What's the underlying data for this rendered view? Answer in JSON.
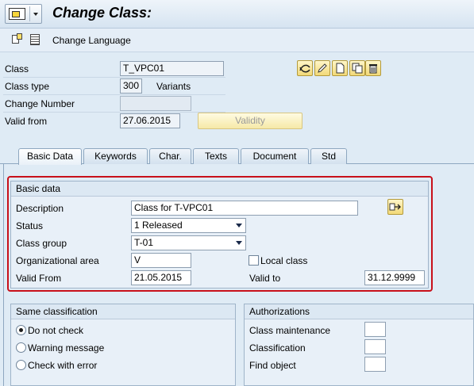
{
  "title": "Change Class:",
  "toolbar": {
    "change_language": "Change Language"
  },
  "header": {
    "class_label": "Class",
    "class_value": "T_VPC01",
    "class_type_label": "Class type",
    "class_type_value": "300",
    "class_type_text": "Variants",
    "change_number_label": "Change Number",
    "change_number_value": "",
    "valid_from_label": "Valid from",
    "valid_from_value": "27.06.2015",
    "validity_button": "Validity"
  },
  "tabs": [
    "Basic Data",
    "Keywords",
    "Char.",
    "Texts",
    "Document",
    "Std"
  ],
  "active_tab": "Basic Data",
  "basic_data": {
    "group_title": "Basic data",
    "description_label": "Description",
    "description_value": "Class for T-VPC01",
    "status_label": "Status",
    "status_value": "1 Released",
    "class_group_label": "Class group",
    "class_group_value": "T-01",
    "org_area_label": "Organizational area",
    "org_area_value": "V",
    "local_class_label": "Local class",
    "local_class_checked": false,
    "valid_from_label": "Valid From",
    "valid_from_value": "21.05.2015",
    "valid_to_label": "Valid to",
    "valid_to_value": "31.12.9999"
  },
  "same_classification": {
    "title": "Same classification",
    "options": [
      "Do not check",
      "Warning message",
      "Check with error"
    ],
    "selected": "Do not check"
  },
  "authorizations": {
    "title": "Authorizations",
    "rows": [
      "Class maintenance",
      "Classification",
      "Find object"
    ]
  },
  "colors": {
    "highlight": "#c8101a",
    "background": "#dfebf5",
    "button_yellow": "#f2d978"
  }
}
